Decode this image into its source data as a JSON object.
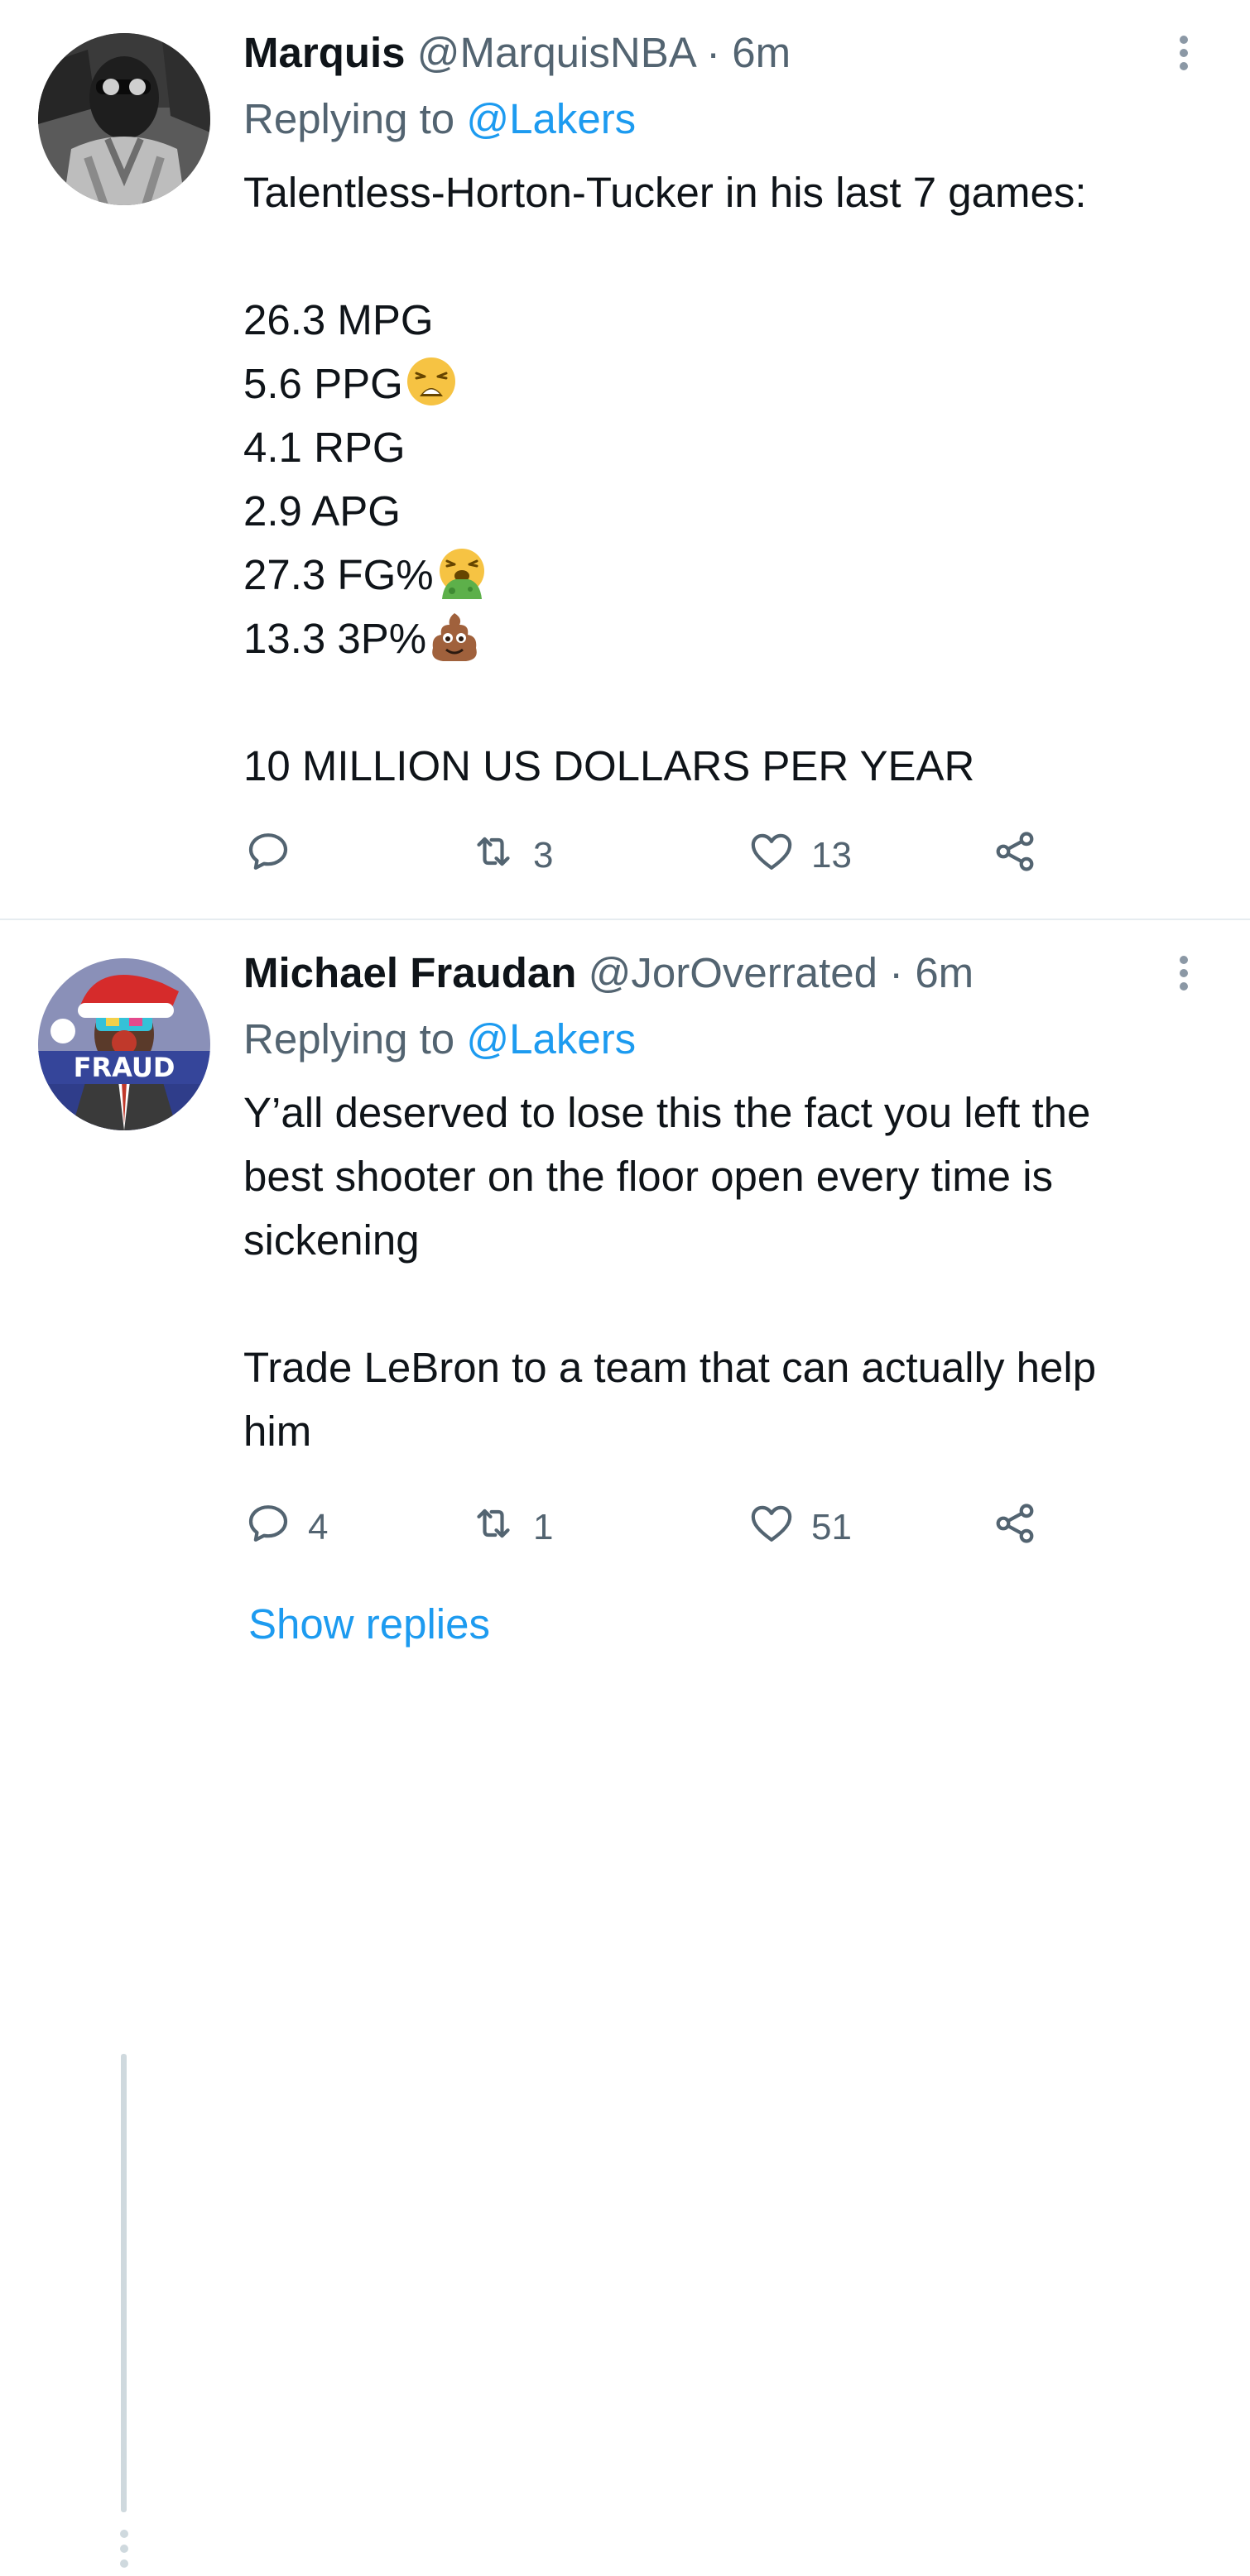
{
  "tweets": [
    {
      "name": "Marquis",
      "handle": "@MarquisNBA",
      "separator": "·",
      "time": "6m",
      "replying_prefix": "Replying to",
      "replying_to": "@Lakers",
      "lines": [
        "Talentless-Horton-Tucker in his last 7 games:",
        "",
        "26.3 MPG",
        "5.6 PPG",
        "4.1 RPG",
        "2.9 APG",
        "27.3 FG%",
        "13.3 3P%",
        "",
        "10 MILLION US DOLLARS PER YEAR"
      ],
      "emojis": {
        "line_3": "weary-face-emoji",
        "line_6": "vomiting-face-emoji",
        "line_7": "pile-of-poo-emoji"
      },
      "actions": {
        "reply_count": "",
        "retweet_count": "3",
        "like_count": "13"
      }
    },
    {
      "name": "Michael Fraudan",
      "handle": "@JorOverrated",
      "separator": "·",
      "time": "6m",
      "replying_prefix": "Replying to",
      "replying_to": "@Lakers",
      "avatar_badge": "FRAUD",
      "lines": [
        "Y’all deserved to lose this the fact you left the",
        "best shooter on the floor open every time is",
        "sickening",
        "",
        "Trade LeBron to a team that can actually help",
        "him"
      ],
      "actions": {
        "reply_count": "4",
        "retweet_count": "1",
        "like_count": "51"
      }
    }
  ],
  "show_replies_label": "Show replies",
  "colors": {
    "text_primary": "#0f1419",
    "text_secondary": "#536471",
    "link": "#1d9bf0",
    "divider": "#e6ecf0",
    "thread_line": "#cfd9de"
  },
  "icons": [
    "more-vertical-icon",
    "reply-icon",
    "retweet-icon",
    "like-icon",
    "share-icon"
  ]
}
